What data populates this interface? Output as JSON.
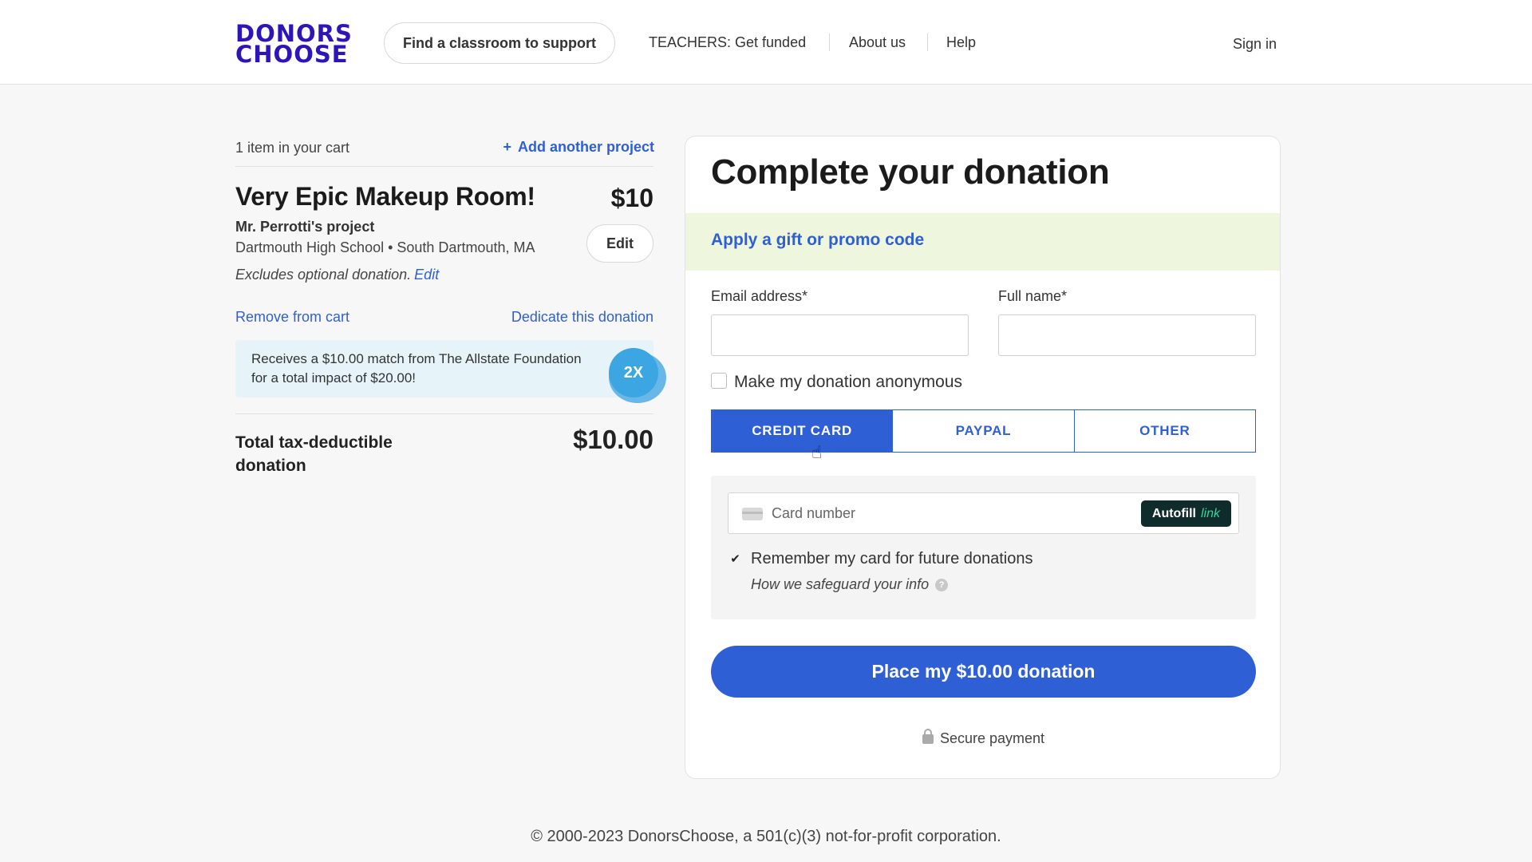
{
  "header": {
    "logo_line1": "DONORS",
    "logo_line2": "CHOOSE",
    "find_classroom": "Find a classroom to support",
    "teachers": "TEACHERS: Get funded",
    "about": "About us",
    "help": "Help",
    "sign_in": "Sign in"
  },
  "cart": {
    "count_label": "1 item in your cart",
    "add_project": "Add another project",
    "project_title": "Very Epic Makeup Room!",
    "project_price": "$10",
    "teacher": "Mr. Perrotti's project",
    "school": "Dartmouth High School • South Dartmouth, MA",
    "edit_button": "Edit",
    "excludes": "Excludes optional donation.",
    "excludes_edit": "Edit",
    "remove": "Remove from cart",
    "dedicate": "Dedicate this donation",
    "match_text": "Receives a $10.00 match from The Allstate Foundation for a total impact of $20.00!",
    "match_badge": "2X",
    "total_label": "Total tax-deductible donation",
    "total_value": "$10.00"
  },
  "donation": {
    "title": "Complete your donation",
    "promo_link": "Apply a gift or promo code",
    "email_label": "Email address*",
    "email_value": "",
    "name_label": "Full name*",
    "name_value": "",
    "anonymous_label": "Make my donation anonymous",
    "anonymous_checked": false,
    "tabs": [
      {
        "label": "CREDIT CARD",
        "active": true
      },
      {
        "label": "PAYPAL",
        "active": false
      },
      {
        "label": "OTHER",
        "active": false
      }
    ],
    "card_placeholder": "Card number",
    "autofill_label": "Autofill",
    "autofill_brand": "link",
    "remember_label": "Remember my card for future donations",
    "remember_checked": true,
    "safeguard": "How we safeguard your info",
    "place_button": "Place my $10.00 donation",
    "secure": "Secure payment"
  },
  "footer": {
    "copyright": "© 2000-2023 DonorsChoose, a 501(c)(3) not-for-profit corporation."
  },
  "colors": {
    "brand": "#2e15b8",
    "accent": "#2f5fd4",
    "promo_bg": "#eef6dd",
    "match_bg": "#e6f4fa"
  }
}
